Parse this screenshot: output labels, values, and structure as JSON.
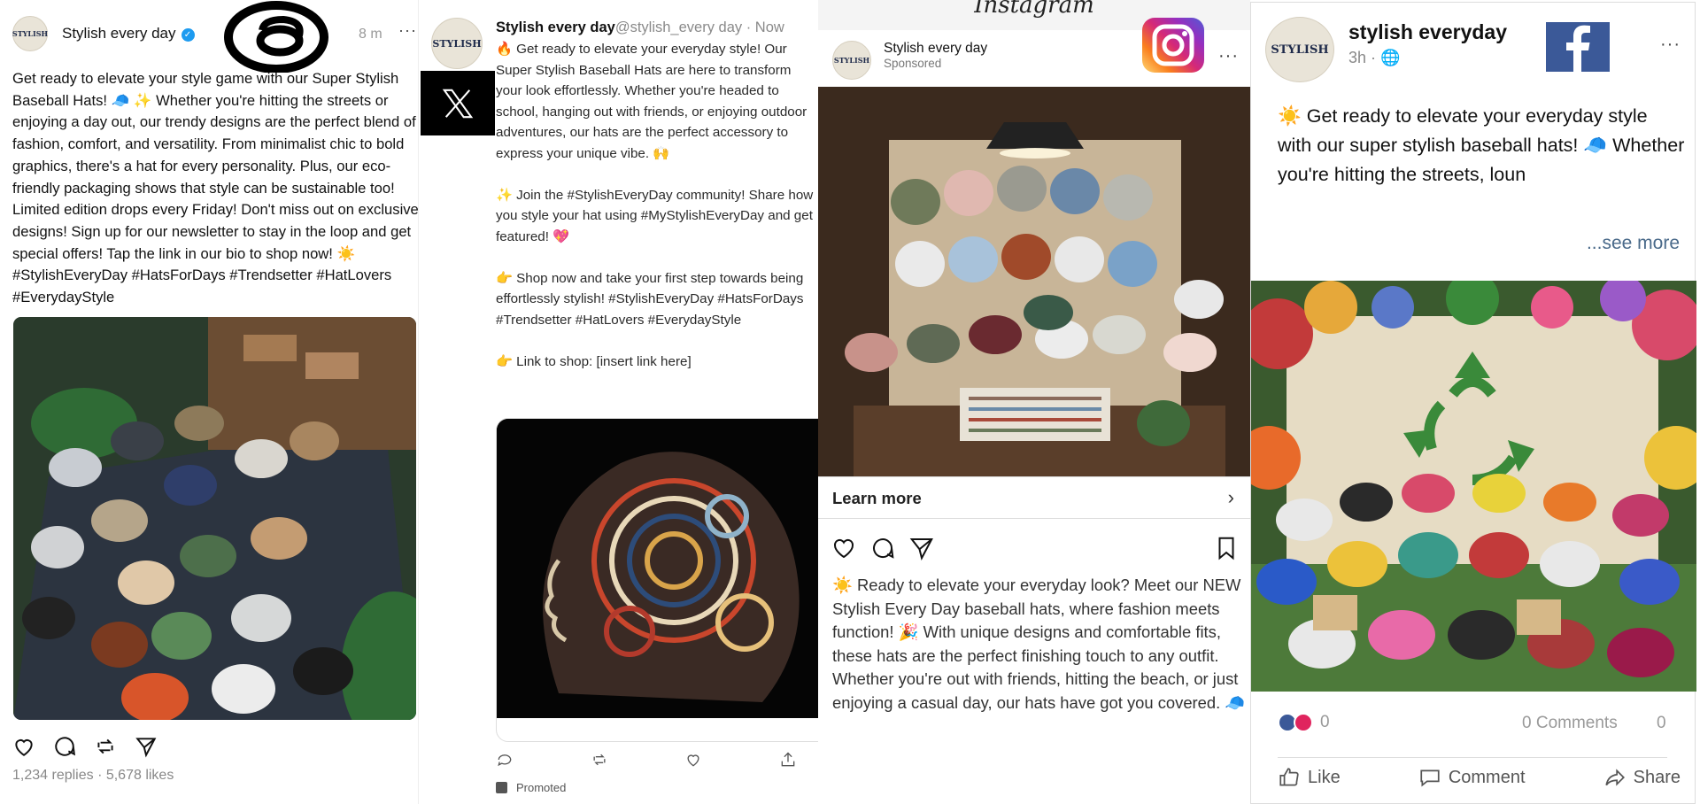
{
  "threads": {
    "author": "Stylish every day",
    "time": "8 m",
    "more": "···",
    "avatar_text": "STYLISH",
    "body": "Get ready to elevate your style game with our Super Stylish Baseball Hats! 🧢 ✨ Whether you're hitting the streets or enjoying a day out, our trendy designs are the perfect blend of fashion, comfort, and versatility. From minimalist chic to bold graphics, there's a hat for every personality. Plus, our eco-friendly packaging shows that style can be sustainable too! Limited edition drops every Friday! Don't miss out on exclusive designs! Sign up for our newsletter to stay in the loop and get special offers! Tap the link in our bio to shop now! ☀️ #StylishEveryDay #HatsForDays #Trendsetter #HatLovers #EverydayStyle",
    "stats": "1,234 replies · 5,678 likes"
  },
  "x": {
    "author": "Stylish every day",
    "handle": "@stylish_every day · Now",
    "avatar_text": "STYLISH",
    "paragraphs": [
      "🔥 Get ready to elevate your everyday style! Our Super Stylish Baseball Hats are here to transform your look effortlessly. Whether you're headed to school, hanging out with friends, or enjoying outdoor adventures, our hats are the perfect accessory to express your unique vibe. 🙌",
      "✨ Join the #StylishEveryDay community! Share how you style your hat using #MyStylishEveryDay and get featured! 💖",
      "👉 Shop now and take your first step towards being effortlessly stylish! #StylishEveryDay #HatsForDays #Trendsetter #HatLovers #EverydayStyle",
      "👉 Link to shop: [insert link here]"
    ],
    "promoted": "Promoted"
  },
  "instagram": {
    "app_title": "Instagram",
    "author": "Stylish every day",
    "sponsored": "Sponsored",
    "avatar_text": "STYLISH",
    "more": "···",
    "learn_more": "Learn more",
    "chevron": "›",
    "caption": "☀️ Ready to elevate your everyday look? Meet our NEW Stylish Every Day baseball hats, where fashion meets function! 🎉 With unique designs and comfortable fits, these hats are the perfect finishing touch to any outfit. Whether you're out with friends, hitting the beach, or just enjoying a casual day, our hats have got you covered. 🧢"
  },
  "facebook": {
    "author": "stylish everyday",
    "time": "3h · 🌐",
    "avatar_text": "STYLISH",
    "more": "···",
    "body": "☀️ Get ready to elevate your everyday style with our super stylish baseball hats! 🧢 Whether you're hitting the streets, loun",
    "see_more": "...see more",
    "reactions_count": "0",
    "comments": "0 Comments",
    "shares": "0",
    "like": "Like",
    "comment": "Comment",
    "share": "Share",
    "brand_color": "#3b5998"
  },
  "colors": {
    "x_bg": "#000000",
    "instagram_gradient": [
      "#feda75",
      "#fa7e1e",
      "#d62976",
      "#962fbf",
      "#4f5bd5"
    ],
    "facebook": "#3b5998"
  },
  "icons": [
    "threads-logo",
    "x-logo",
    "instagram-logo",
    "facebook-logo",
    "heart-icon",
    "comment-icon",
    "repost-icon",
    "share-icon",
    "bookmark-icon",
    "like-icon"
  ]
}
